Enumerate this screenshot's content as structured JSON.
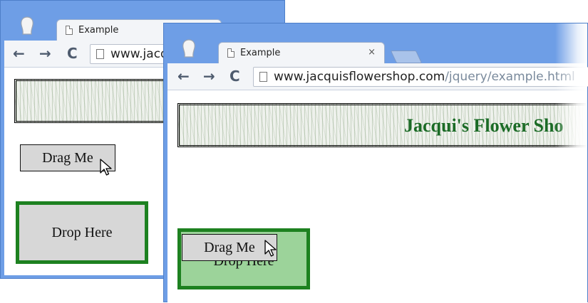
{
  "windows": [
    {
      "tab_title": "Example",
      "url_domain": "www.jacq",
      "url_path": "",
      "drag_label": "Drag Me",
      "drop_label": "Drop Here"
    },
    {
      "tab_title": "Example",
      "tab_close": "×",
      "url_domain": "www.jacquisflowershop.com",
      "url_path": "/jquery/example.html",
      "banner_title": "Jacqui's Flower Sho",
      "drag_label": "Drag Me",
      "drop_label_obscured": "Drop Here"
    }
  ],
  "nav": {
    "back": "←",
    "forward": "→",
    "reload": "C"
  },
  "colors": {
    "window_frame": "#6e9ee6",
    "drop_border": "#1d8120",
    "drop_active_fill": "#9cd39a",
    "drop_idle_fill": "#d7d7d7",
    "banner_text": "#1b6b26"
  },
  "icons": [
    "browser-logo-icon",
    "page-icon",
    "back-arrow-icon",
    "forward-arrow-icon",
    "reload-icon",
    "close-icon",
    "new-tab-icon",
    "mouse-pointer-icon"
  ]
}
